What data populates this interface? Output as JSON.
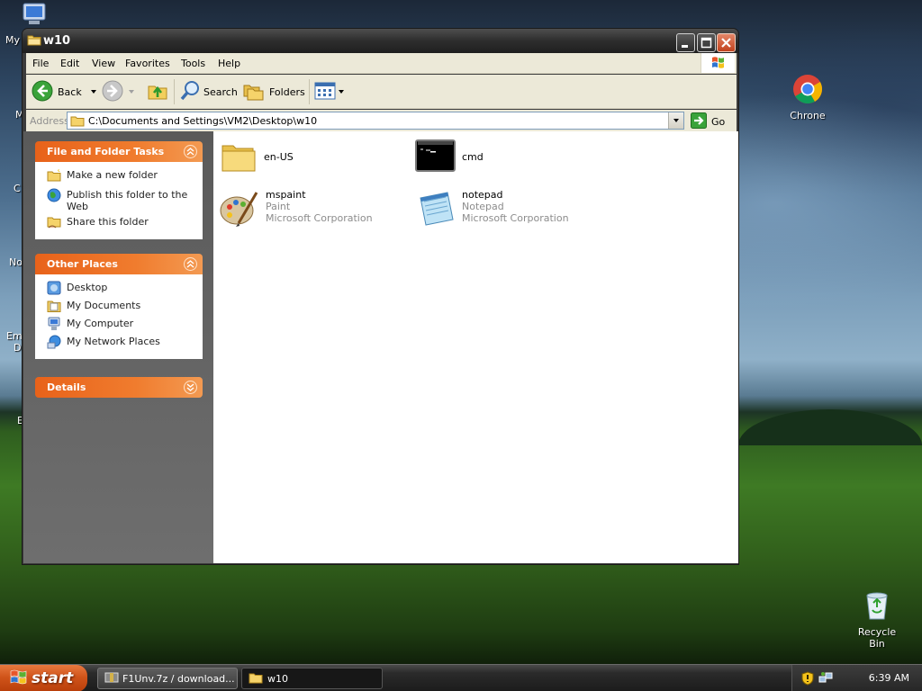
{
  "desktop": {
    "icons": [
      {
        "label": "Chrone"
      },
      {
        "label": "Recycle Bin"
      }
    ],
    "partial_labels": [
      "My",
      "M",
      "C",
      "No",
      "Em",
      "D",
      "E"
    ]
  },
  "window": {
    "title": "w10",
    "menu": [
      "File",
      "Edit",
      "View",
      "Favorites",
      "Tools",
      "Help"
    ],
    "toolbar": {
      "back": "Back",
      "search": "Search",
      "folders": "Folders"
    },
    "address": {
      "label": "Address",
      "value": "C:\\Documents and Settings\\VM2\\Desktop\\w10",
      "go": "Go"
    },
    "taskpane": {
      "file_tasks": {
        "title": "File and Folder Tasks",
        "items": [
          "Make a new folder",
          "Publish this folder to the Web",
          "Share this folder"
        ]
      },
      "other_places": {
        "title": "Other Places",
        "items": [
          "Desktop",
          "My Documents",
          "My Computer",
          "My Network Places"
        ]
      },
      "details": {
        "title": "Details"
      }
    },
    "files": [
      {
        "name": "en-US",
        "icon": "folder-icon"
      },
      {
        "name": "cmd",
        "icon": "cmd-icon"
      },
      {
        "name": "mspaint",
        "line2": "Paint",
        "line3": "Microsoft Corporation",
        "icon": "paint-icon"
      },
      {
        "name": "notepad",
        "line2": "Notepad",
        "line3": "Microsoft Corporation",
        "icon": "notepad-icon"
      }
    ]
  },
  "taskbar": {
    "start": "start",
    "tasks": [
      {
        "label": "F1Unv.7z / download...",
        "active": false
      },
      {
        "label": "w10",
        "active": true
      }
    ],
    "clock": "6:39 AM"
  },
  "colors": {
    "accent_orange": "#e8621a",
    "start_orange": "#d0541a",
    "title_dark": "#2d2d2d"
  }
}
